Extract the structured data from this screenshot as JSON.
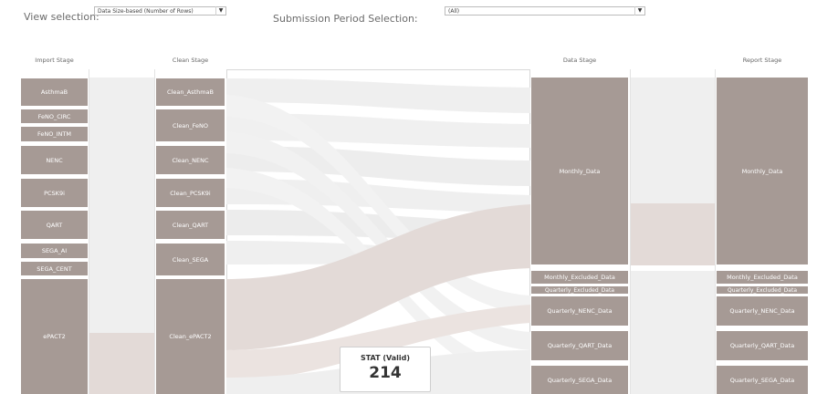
{
  "filters": {
    "view_selection_label": "View selection:",
    "view_selection_value": "Data Size-based (Number of Rows)",
    "submission_period_label": "Submission Period Selection:",
    "submission_period_value": "(All)",
    "dropdown_arrow": "▼"
  },
  "stages": {
    "import": "Import Stage",
    "clean": "Clean Stage",
    "data": "Data Stage",
    "report": "Report Stage"
  },
  "import_nodes": [
    "AsthmaB",
    "FeNO_CIRC",
    "FeNO_INTM",
    "NENC",
    "PCSK9i",
    "QART",
    "SEGA_AI",
    "SEGA_CENT",
    "ePACT2"
  ],
  "clean_nodes": [
    "Clean_AsthmaB",
    "Clean_FeNO",
    "Clean_NENC",
    "Clean_PCSK9i",
    "Clean_QART",
    "Clean_SEGA",
    "Clean_ePACT2"
  ],
  "data_nodes": [
    "Monthly_Data",
    "Monthly_Excluded_Data",
    "Quarterly_Excluded_Data",
    "Quarterly_NENC_Data",
    "Quarterly_QART_Data",
    "Quarterly_SEGA_Data"
  ],
  "report_nodes": [
    "Monthly_Data",
    "Monthly_Excluded_Data",
    "Quarterly_Excluded_Data",
    "Quarterly_NENC_Data",
    "Quarterly_QART_Data",
    "Quarterly_SEGA_Data"
  ],
  "stat": {
    "label": "STAT (Valid)",
    "value": "214"
  },
  "colors": {
    "node": "#a69a95",
    "flow": "#efefef",
    "flow_highlight": "#e3dad7"
  }
}
